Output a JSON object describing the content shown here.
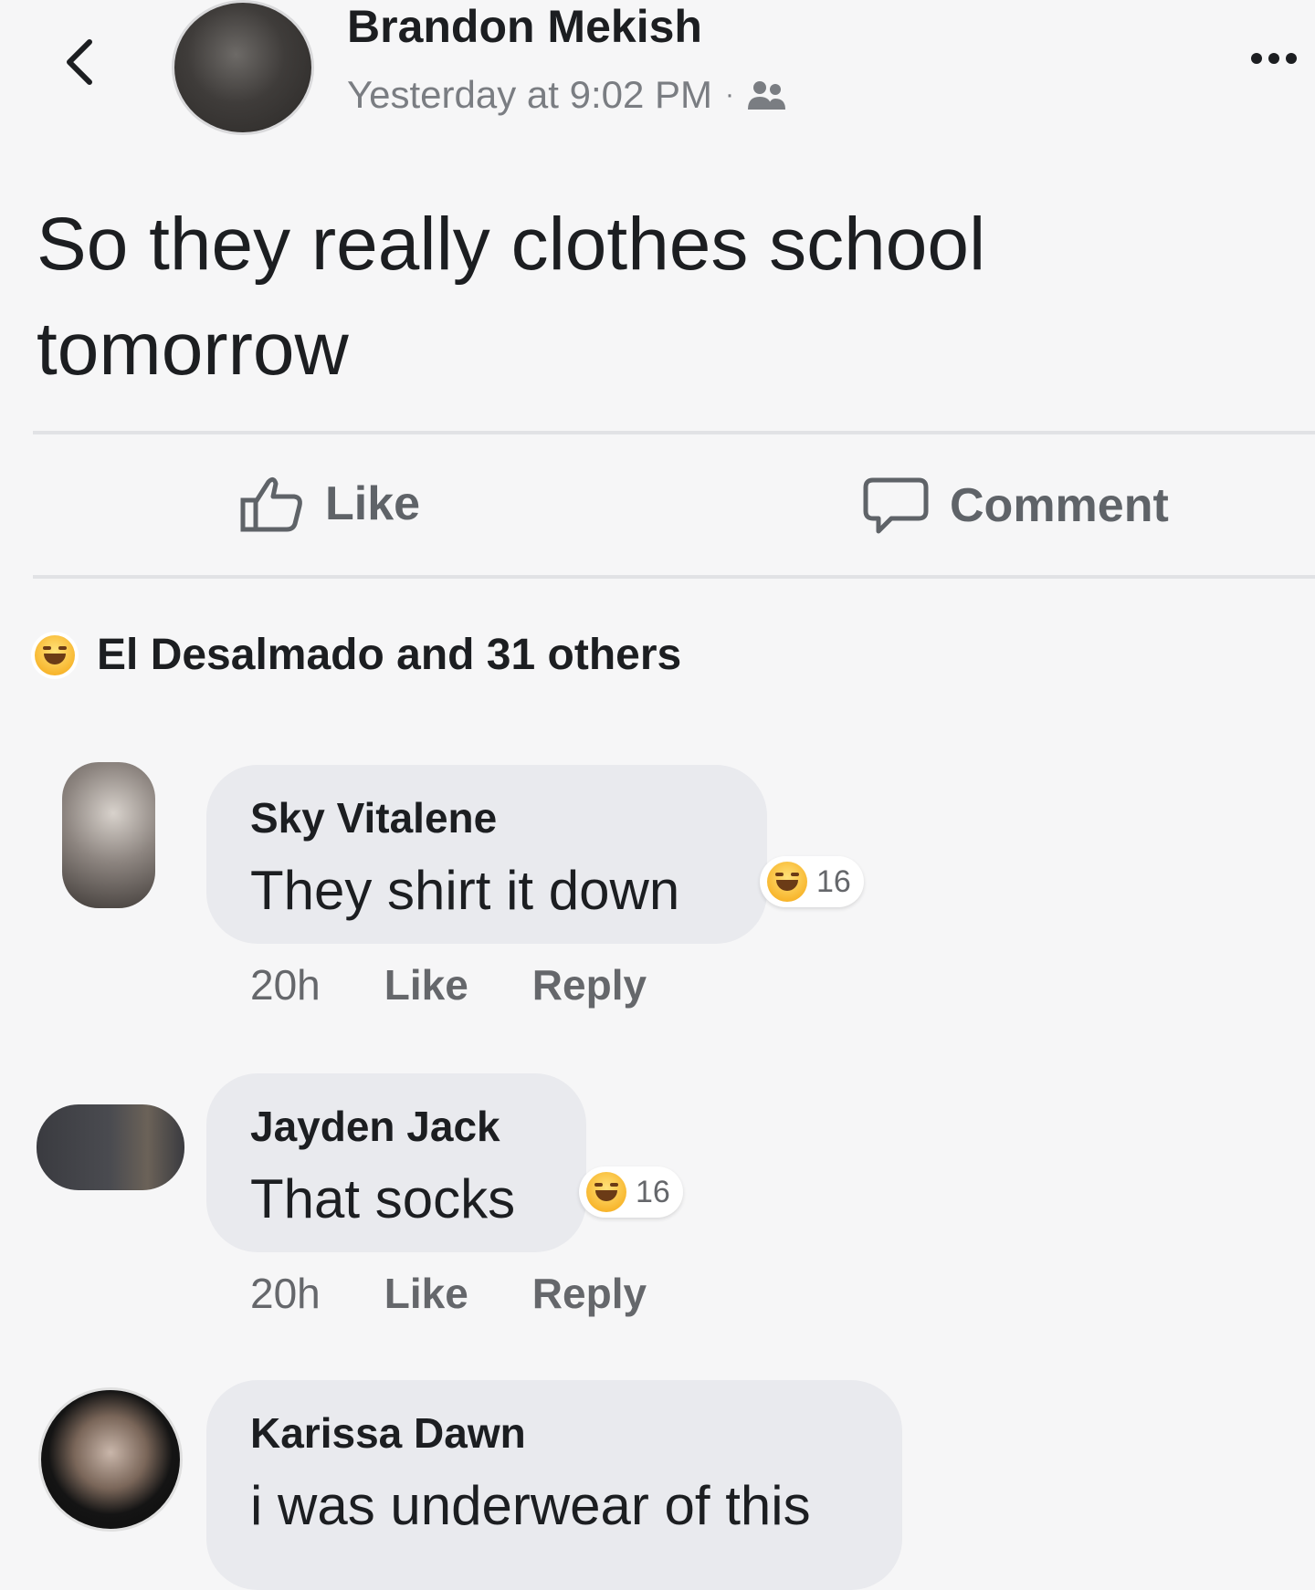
{
  "header": {
    "author_name": "Brandon Mekish",
    "timestamp": "Yesterday at 9:02 PM",
    "separator": "·",
    "audience_icon": "friends-icon",
    "back_icon": "chevron-left-icon",
    "more_icon": "more-dots-icon"
  },
  "post": {
    "text": "So they really clothes school tomorrow"
  },
  "actions": {
    "like_label": "Like",
    "comment_label": "Comment"
  },
  "reactions": {
    "icon": "haha-icon",
    "summary": "El Desalmado and 31 others"
  },
  "comments": [
    {
      "name": "Sky Vitalene",
      "text": "They shirt it down",
      "reaction_count": "16",
      "time": "20h",
      "like_label": "Like",
      "reply_label": "Reply"
    },
    {
      "name": "Jayden Jack",
      "text": "That socks",
      "reaction_count": "16",
      "time": "20h",
      "like_label": "Like",
      "reply_label": "Reply"
    },
    {
      "name": "Karissa Dawn",
      "text": "i was underwear of this"
    }
  ],
  "colors": {
    "background": "#f6f6f7",
    "bubble": "#e9eaee",
    "secondary_text": "#65676b",
    "haha_yellow": "#f7b125"
  }
}
